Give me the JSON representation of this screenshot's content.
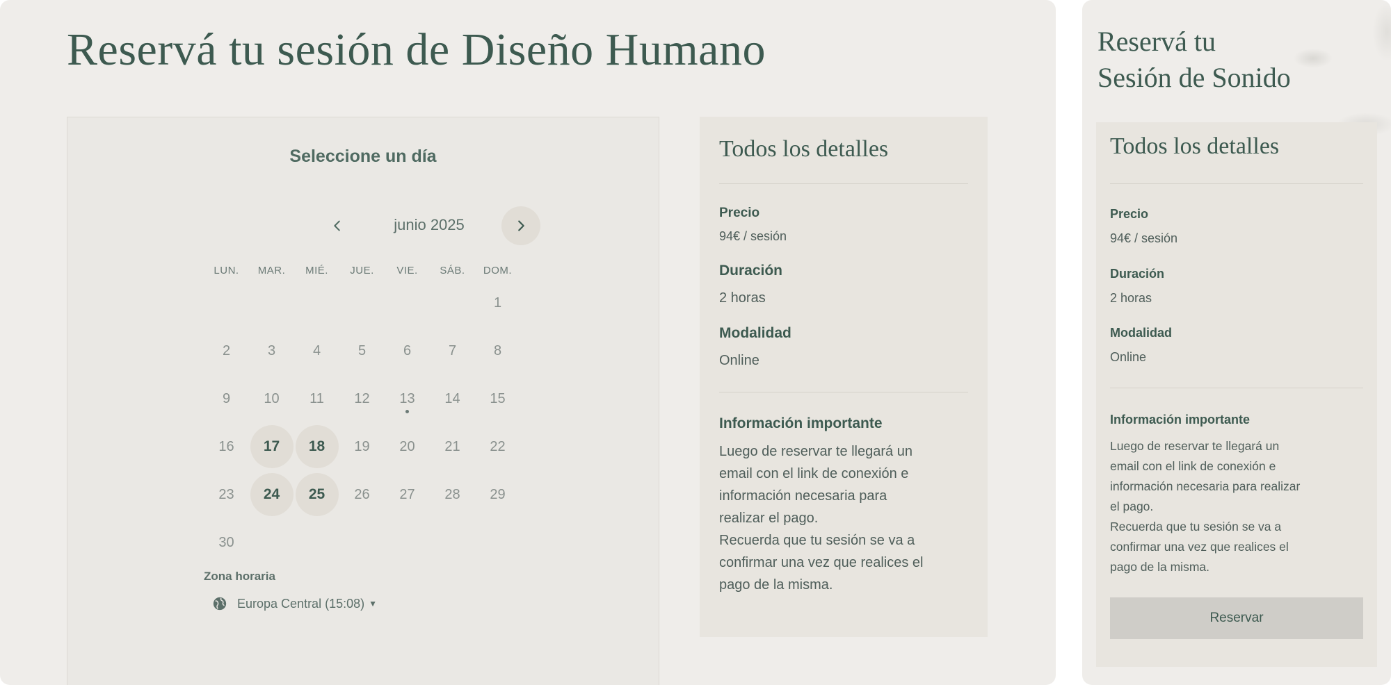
{
  "left": {
    "title": "Reservá tu sesión de Diseño Humano",
    "calendar": {
      "heading": "Seleccione un día",
      "month": "junio 2025",
      "weekdays": [
        "LUN.",
        "MAR.",
        "MIÉ.",
        "JUE.",
        "VIE.",
        "SÁB.",
        "DOM."
      ],
      "first_weekday_index": 6,
      "days_in_month": 30,
      "available_days": [
        17,
        18,
        24,
        25
      ],
      "dotted_days": [
        13
      ],
      "timezone_label": "Zona horaria",
      "timezone_value": "Europa Central (15:08)"
    },
    "details": {
      "title": "Todos los detalles",
      "price_label": "Precio",
      "price_value": "94€ / sesión",
      "duration_label": "Duración",
      "duration_value": "2 horas",
      "mode_label": "Modalidad",
      "mode_value": "Online",
      "info_label": "Información importante",
      "info_lines": [
        "Luego de reservar te llegará un",
        "email con el link de conexión e",
        "información necesaria para",
        "realizar el pago.",
        "Recuerda que tu sesión se va a",
        "confirmar una vez que realices el",
        "pago de la misma."
      ]
    }
  },
  "right": {
    "title_line1": "Reservá tu",
    "title_line2": "Sesión de Sonido",
    "details": {
      "title": "Todos los detalles",
      "price_label": "Precio",
      "price_value": "94€ / sesión",
      "duration_label": "Duración",
      "duration_value": "2 horas",
      "mode_label": "Modalidad",
      "mode_value": "Online",
      "info_label": "Información importante",
      "info_lines": [
        "Luego de reservar te llegará un",
        "email con el link de conexión e",
        "información necesaria para realizar",
        "el pago.",
        "Recuerda que tu sesión se va a",
        "confirmar una vez que realices el",
        "pago de la misma."
      ]
    },
    "reserve_label": "Reservar"
  },
  "icons": {
    "prev": "chevron-left-icon",
    "next": "chevron-right-icon",
    "globe": "globe-icon",
    "caret": "caret-down-icon"
  }
}
